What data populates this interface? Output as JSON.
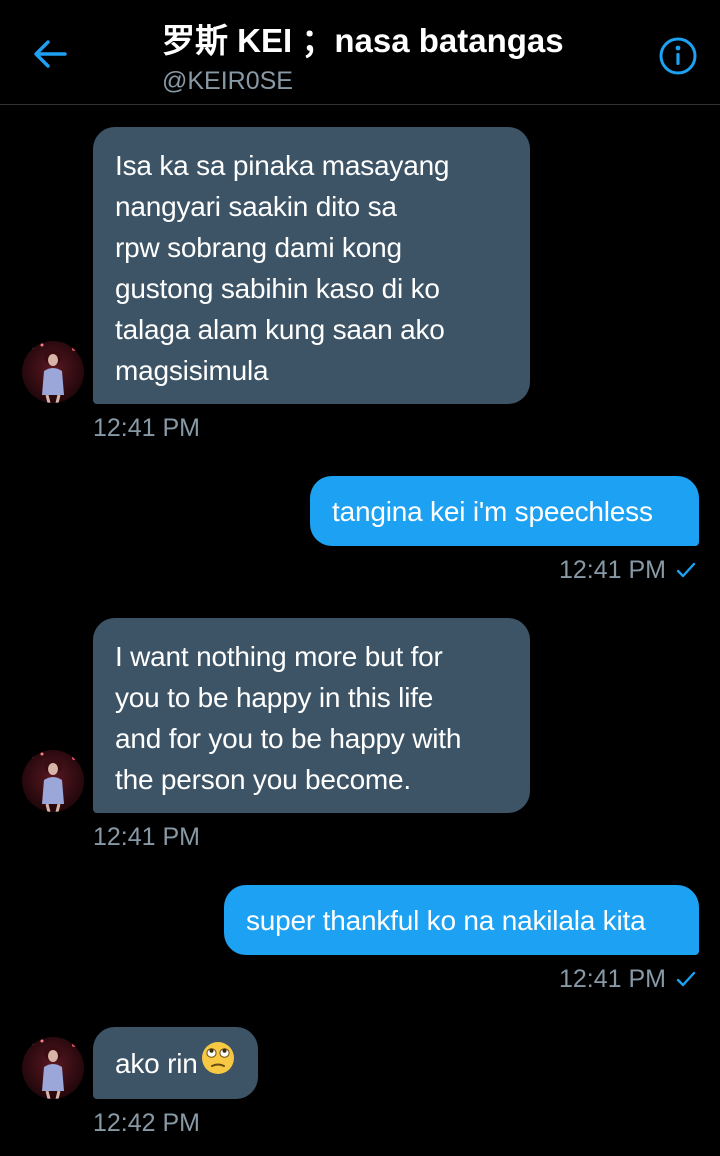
{
  "header": {
    "back_icon": "arrow-left-icon",
    "title": "罗斯 KEI ；nasa batangas",
    "handle": "@KEIR0SE",
    "info_icon": "info-circle-icon",
    "accent_color": "#1da1f2"
  },
  "messages": [
    {
      "direction": "incoming",
      "text": "Isa ka sa pinaka masayang\nnangyari saakin dito sa\nrpw sobrang dami kong\ngustong sabihin kaso di ko\ntalaga alam kung saan ako\nmagsisimula",
      "time": "12:41 PM"
    },
    {
      "direction": "outgoing",
      "text": "tangina kei i'm speechless",
      "time": "12:41 PM",
      "status_icon": "checkmark-icon"
    },
    {
      "direction": "incoming",
      "text": "I want nothing more but for\nyou to be happy in this life\nand for you to be happy with\nthe person you become.",
      "time": "12:41 PM"
    },
    {
      "direction": "outgoing",
      "text": "super thankful ko na nakilala kita",
      "time": "12:41 PM",
      "status_icon": "checkmark-icon"
    },
    {
      "direction": "incoming",
      "text": "ako rin",
      "emoji": "eye-roll-emoji-icon",
      "time": "12:42 PM"
    }
  ],
  "colors": {
    "background": "#000000",
    "incoming_bubble": "#3d5466",
    "outgoing_bubble": "#1da1f2",
    "secondary_text": "#8899a6"
  }
}
